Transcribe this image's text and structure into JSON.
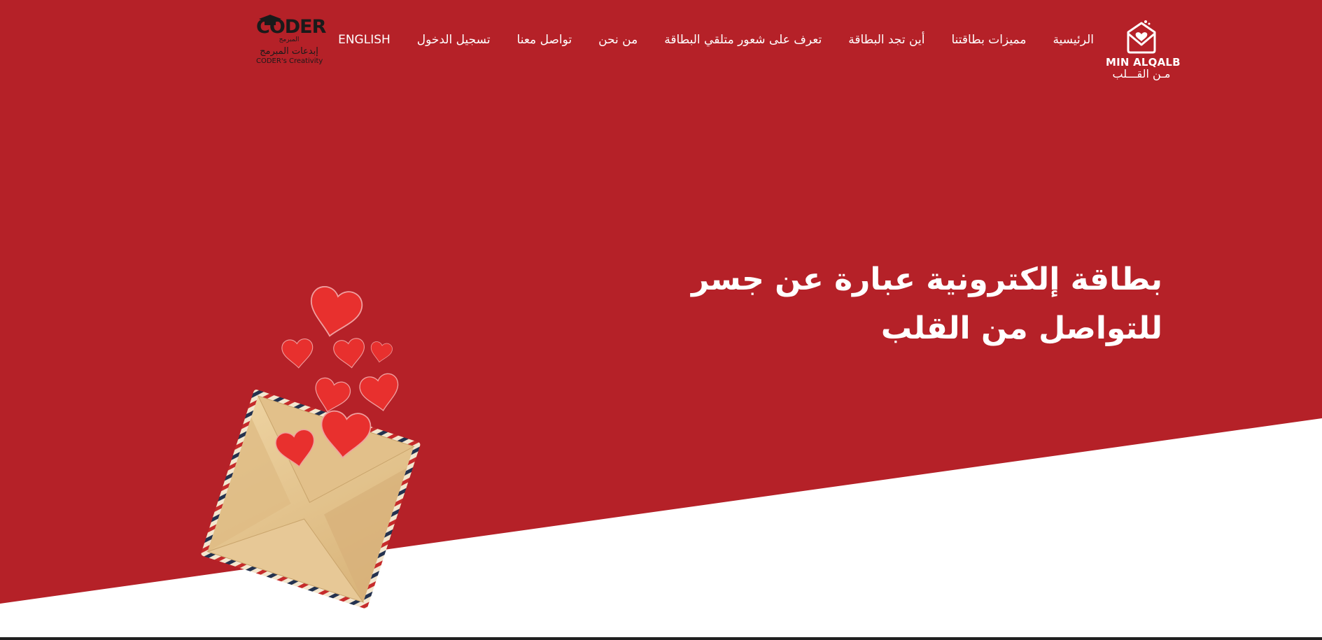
{
  "colors": {
    "hero_red": "#B52128",
    "text_white": "#FFFFFF",
    "footer_line": "#1F1F1F",
    "heart_red": "#E8302E",
    "envelope_kraft": "#E9C992"
  },
  "brand": {
    "name_en": "MIN ALQALB",
    "name_ar": "مـن القـــلب",
    "icon": "envelope-heart-icon"
  },
  "nav": {
    "items": [
      {
        "label": "الرئيسية",
        "name": "nav-home"
      },
      {
        "label": "مميزات بطاقتنا",
        "name": "nav-features"
      },
      {
        "label": "أين تجد البطاقة",
        "name": "nav-where"
      },
      {
        "label": "تعرف على شعور متلقي البطاقة",
        "name": "nav-feelings"
      },
      {
        "label": "من نحن",
        "name": "nav-about"
      },
      {
        "label": "تواصل معنا",
        "name": "nav-contact"
      },
      {
        "label": "تسجيل الدخول",
        "name": "nav-login"
      },
      {
        "label": "ENGLISH",
        "name": "nav-english"
      }
    ]
  },
  "partner": {
    "word": "CODER",
    "ar_small": "المبرمج",
    "ar": "إبدعات المبرمج",
    "en": "CODER's Creativity"
  },
  "hero": {
    "headline": "بطاقة إلكترونية عبارة عن جسر للتواصل من القلب",
    "illustration": "envelope-with-hearts-image"
  }
}
